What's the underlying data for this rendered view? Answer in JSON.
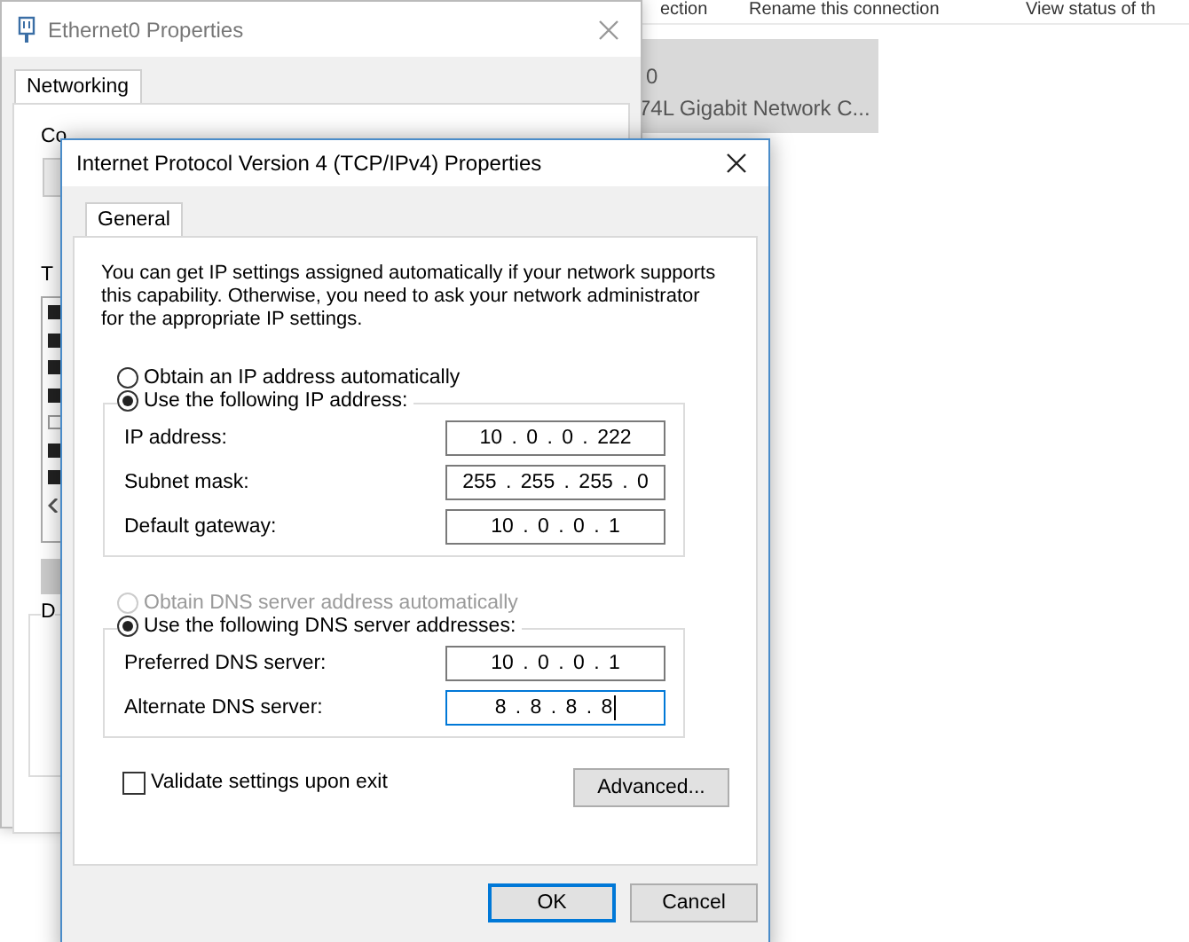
{
  "desktop": {
    "toolbar": [
      "ection",
      "Rename this connection",
      "View status of th"
    ],
    "adapter_card": {
      "line_1": "0",
      "line_2": "74L Gigabit Network C..."
    }
  },
  "back_window": {
    "title": "Ethernet0 Properties",
    "tabs": [
      {
        "label": "Networking",
        "selected": true
      }
    ],
    "fragments": [
      "Co",
      "T",
      "D"
    ],
    "items": [
      {
        "checked": true
      },
      {
        "checked": true
      },
      {
        "checked": true
      },
      {
        "checked": true
      },
      {
        "checked": false
      },
      {
        "checked": true
      },
      {
        "checked": true
      }
    ]
  },
  "dialog": {
    "title": "Internet Protocol Version 4 (TCP/IPv4) Properties",
    "tabs": [
      {
        "label": "General",
        "selected": true
      }
    ],
    "intro": "You can get IP settings assigned automatically if your network supports this capability. Otherwise, you need to ask your network administrator for the appropriate IP settings.",
    "ip_options": [
      {
        "label": "Obtain an IP address automatically",
        "selected": false,
        "disabled": false
      },
      {
        "label": "Use the following IP address:",
        "selected": true,
        "disabled": false
      }
    ],
    "ip_fields": [
      {
        "label": "IP address:",
        "value": "10 . 0 . 0 . 222",
        "focused": false
      },
      {
        "label": "Subnet mask:",
        "value": "255 . 255 . 255 . 0",
        "focused": false
      },
      {
        "label": "Default gateway:",
        "value": "10 . 0 . 0 . 1",
        "focused": false
      }
    ],
    "dns_options": [
      {
        "label": "Obtain DNS server address automatically",
        "selected": false,
        "disabled": true
      },
      {
        "label": "Use the following DNS server addresses:",
        "selected": true,
        "disabled": false
      }
    ],
    "dns_fields": [
      {
        "label": "Preferred DNS server:",
        "value": "10 . 0 . 0 . 1",
        "focused": false
      },
      {
        "label": "Alternate DNS server:",
        "value": "8 . 8 . 8 . 8",
        "focused": true
      }
    ],
    "validate": {
      "label": "Validate settings upon exit",
      "checked": false
    },
    "advanced_button": "Advanced...",
    "buttons": [
      {
        "label": "OK",
        "default": true
      },
      {
        "label": "Cancel",
        "default": false
      }
    ]
  }
}
